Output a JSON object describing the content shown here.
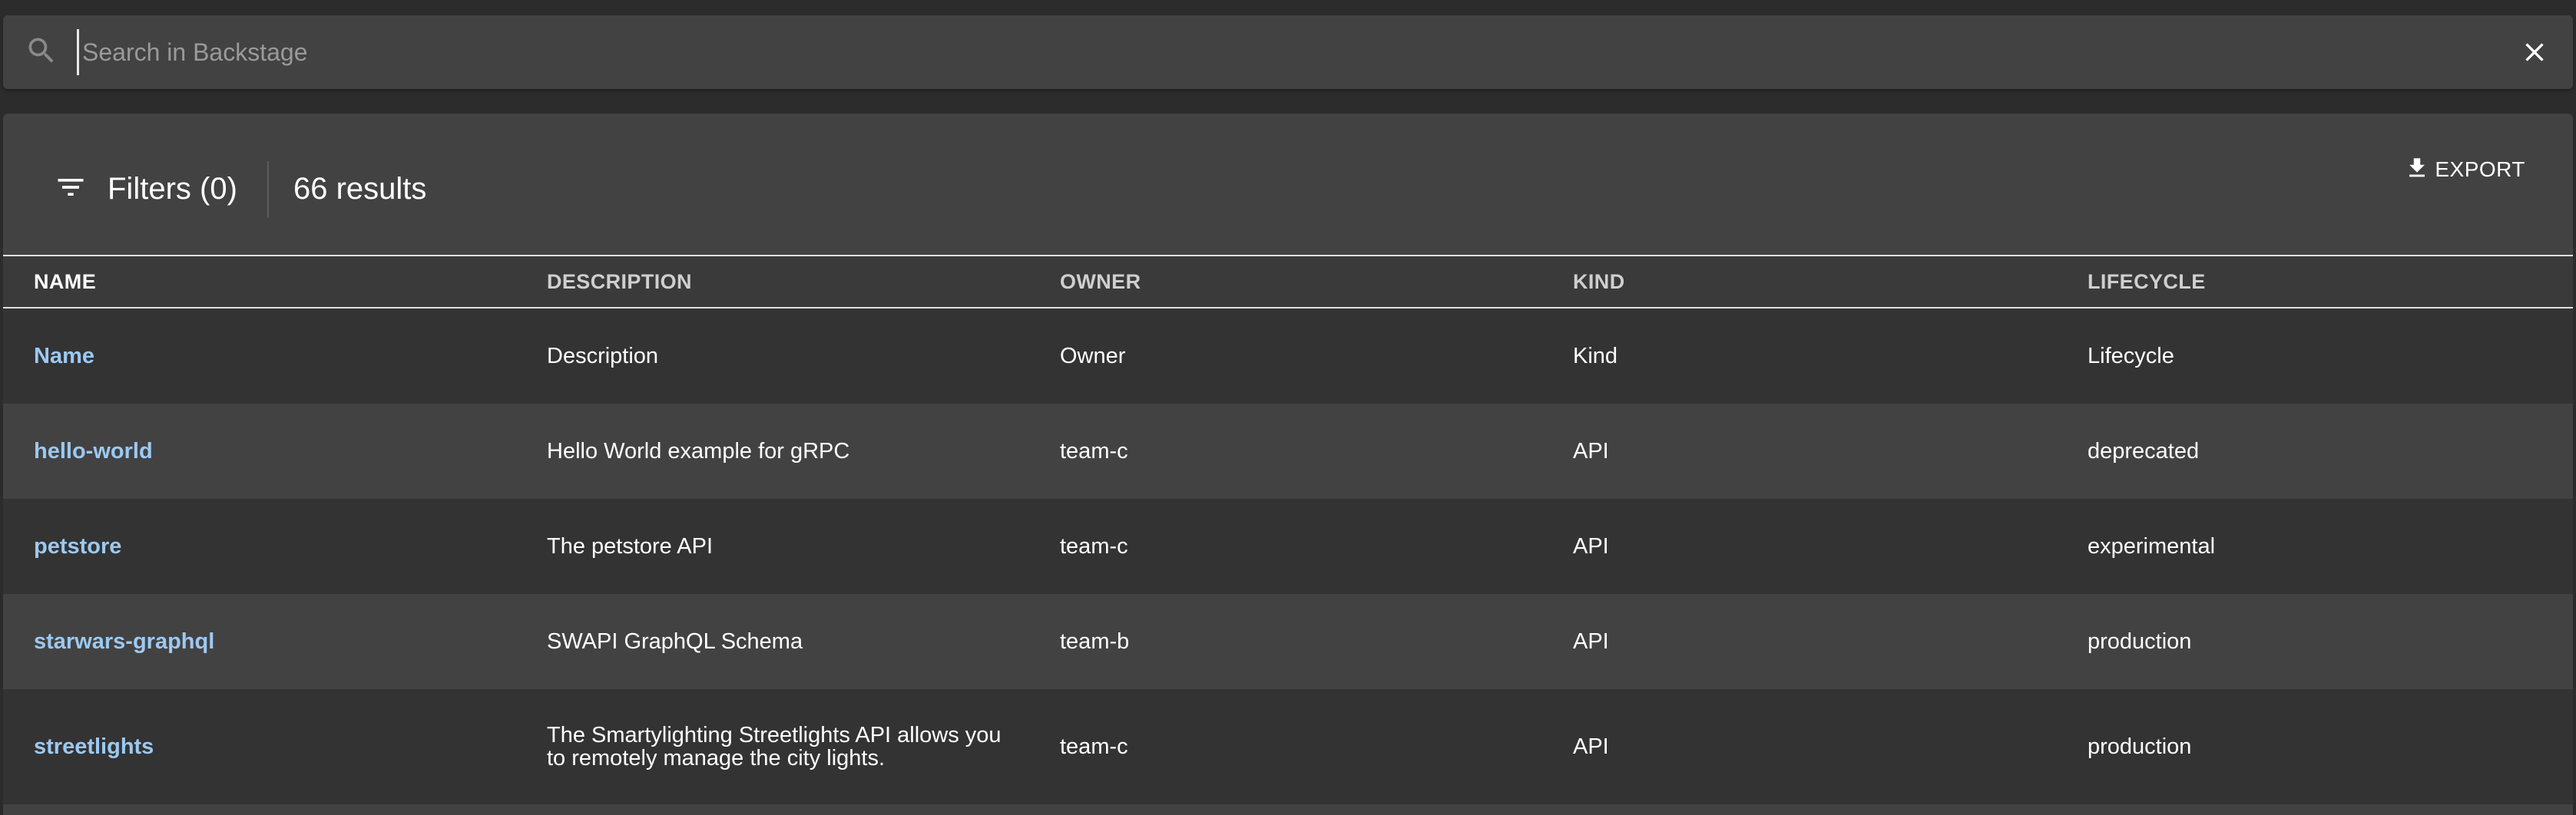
{
  "search": {
    "placeholder": "Search in Backstage",
    "value": ""
  },
  "toolbar": {
    "filters_label": "Filters (0)",
    "results_count": "66 results",
    "export_label": "EXPORT"
  },
  "table": {
    "columns": [
      "NAME",
      "DESCRIPTION",
      "OWNER",
      "KIND",
      "LIFECYCLE"
    ],
    "rows": [
      {
        "name": "Name",
        "description": "Description",
        "owner": "Owner",
        "kind": "Kind",
        "lifecycle": "Lifecycle"
      },
      {
        "name": "hello-world",
        "description": "Hello World example for gRPC",
        "owner": "team-c",
        "kind": "API",
        "lifecycle": "deprecated"
      },
      {
        "name": "petstore",
        "description": "The petstore API",
        "owner": "team-c",
        "kind": "API",
        "lifecycle": "experimental"
      },
      {
        "name": "starwars-graphql",
        "description": "SWAPI GraphQL Schema",
        "owner": "team-b",
        "kind": "API",
        "lifecycle": "production"
      },
      {
        "name": "streetlights",
        "description": "The Smartylighting Streetlights API allows you to remotely manage the city lights.",
        "owner": "team-c",
        "kind": "API",
        "lifecycle": "production"
      }
    ]
  },
  "icons": {
    "search": "search-icon",
    "close": "close-icon",
    "filter": "filter-list-icon",
    "download": "download-icon"
  },
  "colors": {
    "background": "#2c2c2c",
    "panel": "#424242",
    "link": "#9cc9f2",
    "text": "#ffffff"
  }
}
